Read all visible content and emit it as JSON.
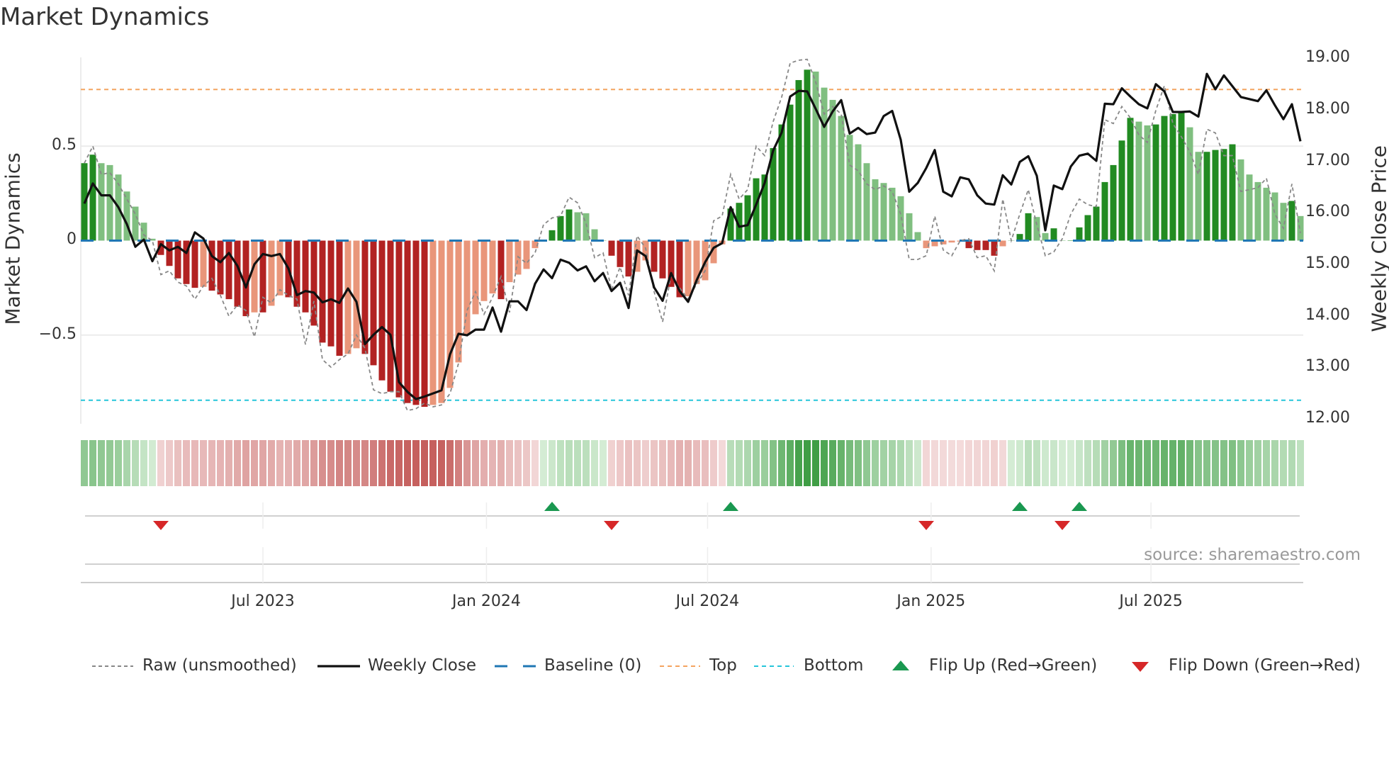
{
  "chart_data": {
    "type": "bar",
    "title": "Market Dynamics",
    "ylabel_left": "Market Dynamics",
    "ylabel_right": "Weekly Close Price",
    "frequency": "weekly",
    "start_date": "2023-02-04",
    "ylim_left": [
      -0.97,
      0.97
    ],
    "ylim_right": [
      11.9,
      19.02
    ],
    "left_ticks": [
      {
        "value": 0.5,
        "label": "0.5"
      },
      {
        "value": 0,
        "label": "0"
      },
      {
        "value": -0.5,
        "label": "−0.5"
      }
    ],
    "right_ticks": [
      {
        "value": 19,
        "label": "19.00"
      },
      {
        "value": 18,
        "label": "18.00"
      },
      {
        "value": 17,
        "label": "17.00"
      },
      {
        "value": 16,
        "label": "16.00"
      },
      {
        "value": 15,
        "label": "15.00"
      },
      {
        "value": 14,
        "label": "14.00"
      },
      {
        "value": 13,
        "label": "13.00"
      },
      {
        "value": 12,
        "label": "12.00"
      }
    ],
    "x_ticks": [
      {
        "date": "2023-07-01",
        "label": "Jul 2023"
      },
      {
        "date": "2024-01-01",
        "label": "Jan 2024"
      },
      {
        "date": "2024-07-01",
        "label": "Jul 2024"
      },
      {
        "date": "2025-01-01",
        "label": "Jan 2025"
      },
      {
        "date": "2025-07-01",
        "label": "Jul 2025"
      }
    ],
    "levels": {
      "baseline": 0,
      "top": 0.8,
      "bottom": -0.845
    },
    "momentum": [
      0.41,
      0.455,
      0.41,
      0.4,
      0.35,
      0.26,
      0.18,
      0.095,
      0.01,
      -0.076,
      -0.134,
      -0.2,
      -0.23,
      -0.25,
      -0.245,
      -0.265,
      -0.285,
      -0.31,
      -0.35,
      -0.4,
      -0.38,
      -0.38,
      -0.345,
      -0.29,
      -0.3,
      -0.35,
      -0.38,
      -0.45,
      -0.54,
      -0.56,
      -0.61,
      -0.6,
      -0.57,
      -0.6,
      -0.66,
      -0.74,
      -0.8,
      -0.83,
      -0.86,
      -0.87,
      -0.88,
      -0.87,
      -0.86,
      -0.78,
      -0.645,
      -0.5,
      -0.39,
      -0.32,
      -0.28,
      -0.31,
      -0.22,
      -0.18,
      -0.15,
      -0.04,
      0.0,
      0.055,
      0.13,
      0.165,
      0.15,
      0.145,
      0.06,
      0.0,
      -0.08,
      -0.14,
      -0.19,
      -0.165,
      -0.105,
      -0.165,
      -0.2,
      -0.245,
      -0.3,
      -0.295,
      -0.23,
      -0.21,
      -0.12,
      -0.02,
      0.17,
      0.2,
      0.24,
      0.33,
      0.35,
      0.49,
      0.615,
      0.72,
      0.85,
      0.905,
      0.895,
      0.81,
      0.745,
      0.66,
      0.56,
      0.51,
      0.41,
      0.325,
      0.305,
      0.28,
      0.235,
      0.145,
      0.045,
      -0.04,
      -0.03,
      -0.02,
      -0.01,
      -0.005,
      -0.04,
      -0.05,
      -0.05,
      -0.08,
      -0.03,
      0.0,
      0.035,
      0.145,
      0.125,
      0.04,
      0.065,
      0.0,
      0.0,
      0.07,
      0.135,
      0.18,
      0.31,
      0.4,
      0.53,
      0.65,
      0.63,
      0.61,
      0.615,
      0.66,
      0.67,
      0.68,
      0.6,
      0.47,
      0.47,
      0.48,
      0.485,
      0.51,
      0.43,
      0.35,
      0.31,
      0.28,
      0.255,
      0.2,
      0.21,
      0.13
    ],
    "raw": [
      0.41,
      0.5,
      0.35,
      0.36,
      0.3,
      0.22,
      0.14,
      0.03,
      0.0,
      -0.18,
      -0.16,
      -0.22,
      -0.24,
      -0.31,
      -0.24,
      -0.2,
      -0.29,
      -0.4,
      -0.34,
      -0.37,
      -0.51,
      -0.3,
      -0.33,
      -0.26,
      -0.29,
      -0.31,
      -0.55,
      -0.32,
      -0.63,
      -0.67,
      -0.63,
      -0.6,
      -0.5,
      -0.57,
      -0.79,
      -0.81,
      -0.8,
      -0.8,
      -0.9,
      -0.89,
      -0.86,
      -0.88,
      -0.87,
      -0.81,
      -0.65,
      -0.37,
      -0.27,
      -0.39,
      -0.3,
      -0.19,
      -0.38,
      -0.085,
      -0.12,
      -0.065,
      0.085,
      0.12,
      0.13,
      0.23,
      0.2,
      0.09,
      -0.09,
      -0.065,
      -0.26,
      -0.14,
      -0.29,
      0.025,
      -0.04,
      -0.27,
      -0.43,
      -0.18,
      -0.25,
      -0.31,
      -0.23,
      -0.16,
      0.105,
      0.13,
      0.35,
      0.22,
      0.27,
      0.5,
      0.45,
      0.63,
      0.76,
      0.94,
      0.955,
      0.96,
      0.84,
      0.67,
      0.71,
      0.67,
      0.4,
      0.37,
      0.3,
      0.27,
      0.29,
      0.26,
      0.14,
      -0.1,
      -0.1,
      -0.08,
      0.13,
      -0.05,
      -0.08,
      0.0,
      0.01,
      -0.09,
      -0.08,
      -0.16,
      0.22,
      0.0,
      0.14,
      0.27,
      0.085,
      -0.08,
      -0.06,
      0.01,
      0.14,
      0.22,
      0.19,
      0.18,
      0.64,
      0.62,
      0.71,
      0.65,
      0.56,
      0.52,
      0.69,
      0.82,
      0.62,
      0.55,
      0.47,
      0.35,
      0.59,
      0.57,
      0.45,
      0.45,
      0.26,
      0.27,
      0.28,
      0.33,
      0.14,
      0.065,
      0.3,
      0.04
    ],
    "close": [
      16.18,
      16.57,
      16.34,
      16.34,
      16.11,
      15.78,
      15.34,
      15.48,
      15.06,
      15.39,
      15.27,
      15.34,
      15.22,
      15.62,
      15.5,
      15.16,
      15.04,
      15.22,
      14.97,
      14.55,
      15.0,
      15.2,
      15.16,
      15.2,
      14.92,
      14.4,
      14.48,
      14.45,
      14.26,
      14.32,
      14.25,
      14.53,
      14.27,
      13.45,
      13.63,
      13.78,
      13.63,
      12.71,
      12.52,
      12.38,
      12.43,
      12.49,
      12.55,
      13.25,
      13.65,
      13.62,
      13.73,
      13.73,
      14.16,
      13.69,
      14.28,
      14.28,
      14.11,
      14.62,
      14.9,
      14.73,
      15.09,
      15.03,
      14.88,
      14.96,
      14.67,
      14.83,
      14.48,
      14.64,
      14.15,
      15.27,
      15.16,
      14.55,
      14.29,
      14.83,
      14.48,
      14.27,
      14.69,
      15.04,
      15.32,
      15.41,
      16.11,
      15.73,
      15.76,
      16.16,
      16.58,
      17.21,
      17.56,
      18.26,
      18.37,
      18.36,
      18.02,
      17.67,
      17.97,
      18.19,
      17.54,
      17.65,
      17.53,
      17.56,
      17.88,
      17.98,
      17.42,
      16.41,
      16.58,
      16.87,
      17.22,
      16.41,
      16.32,
      16.69,
      16.65,
      16.34,
      16.18,
      16.16,
      16.73,
      16.55,
      16.99,
      17.1,
      16.72,
      15.66,
      16.53,
      16.46,
      16.9,
      17.11,
      17.15,
      17.01,
      18.12,
      18.11,
      18.42,
      18.26,
      18.11,
      18.03,
      18.5,
      18.36,
      17.96,
      17.96,
      17.97,
      17.87,
      18.7,
      18.4,
      18.67,
      18.46,
      18.25,
      18.21,
      18.17,
      18.38,
      18.09,
      17.82,
      18.11,
      17.39
    ],
    "flips_up": [
      "2024-02-24",
      "2024-07-20",
      "2025-03-15",
      "2025-05-03"
    ],
    "flips_down": [
      "2023-04-08",
      "2024-04-13",
      "2024-12-28",
      "2025-04-19"
    ],
    "legend": {
      "placement": "bottom",
      "items": [
        "Raw (unsmoothed)",
        "Weekly Close",
        "Baseline (0)",
        "Top",
        "Bottom",
        "Flip Up (Red→Green)",
        "Flip Down (Green→Red)"
      ]
    },
    "colors": {
      "pos_strong": "#228b22",
      "pos_weak": "#80bf80",
      "neg_strong": "#b22222",
      "neg_weak": "#e9967a",
      "raw": "#888888",
      "close": "#111111",
      "baseline": "#1f77b4",
      "top": "#f4a460",
      "bottom": "#26c6da",
      "flip_up": "#1a9850",
      "flip_down": "#d62728"
    }
  },
  "source": "source: sharemaestro.com"
}
